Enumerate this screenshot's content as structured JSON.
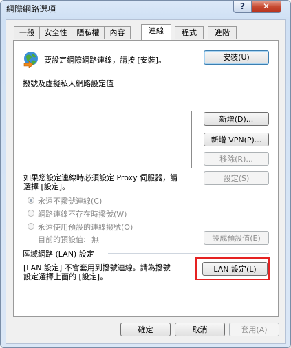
{
  "window": {
    "title": "網際網路選項",
    "help_label": "?",
    "close_label": "✕"
  },
  "tabs": [
    {
      "label": "一般",
      "active": false
    },
    {
      "label": "安全性",
      "active": false
    },
    {
      "label": "隱私權",
      "active": false
    },
    {
      "label": "內容",
      "active": false
    },
    {
      "label": "連線",
      "active": true
    },
    {
      "label": "程式",
      "active": false
    },
    {
      "label": "進階",
      "active": false
    }
  ],
  "setup": {
    "text": "要設定網際網路連線，請按 [安裝]。",
    "button": "安裝(U)",
    "icon": "globe-icon"
  },
  "vpn": {
    "group_label": "撥號及虛擬私人網路設定值",
    "add_button": "新增(D)...",
    "add_vpn_button": "新增 VPN(P)...",
    "remove_button": "移除(R)...",
    "settings_note_line1": "如果您設定連線時必須設定 Proxy 伺服器，請",
    "settings_note_line2": "選擇 [設定]。",
    "settings_button": "設定(S)"
  },
  "dial_options": {
    "never_dial": "永遠不撥號連線(C)",
    "dial_when_no_network": "網路連線不存在時撥號(W)",
    "always_dial_default": "永遠使用預設的連線撥號(O)",
    "current_default_label": "目前的預設值:",
    "current_default_value": "無",
    "set_default_button": "設成預設值(E)"
  },
  "lan": {
    "group_label": "區域網路 (LAN) 設定",
    "note_line1": "[LAN 設定] 不會套用到撥號連線。請為撥號",
    "note_line2": "設定選擇上面的 [設定]。",
    "button": "LAN 設定(L)"
  },
  "footer": {
    "ok": "確定",
    "cancel": "取消",
    "apply": "套用(A)"
  },
  "colors": {
    "highlight": "#e52222",
    "dialog_bg": "#f0f0f0",
    "title_bg": "#dce9f8"
  }
}
